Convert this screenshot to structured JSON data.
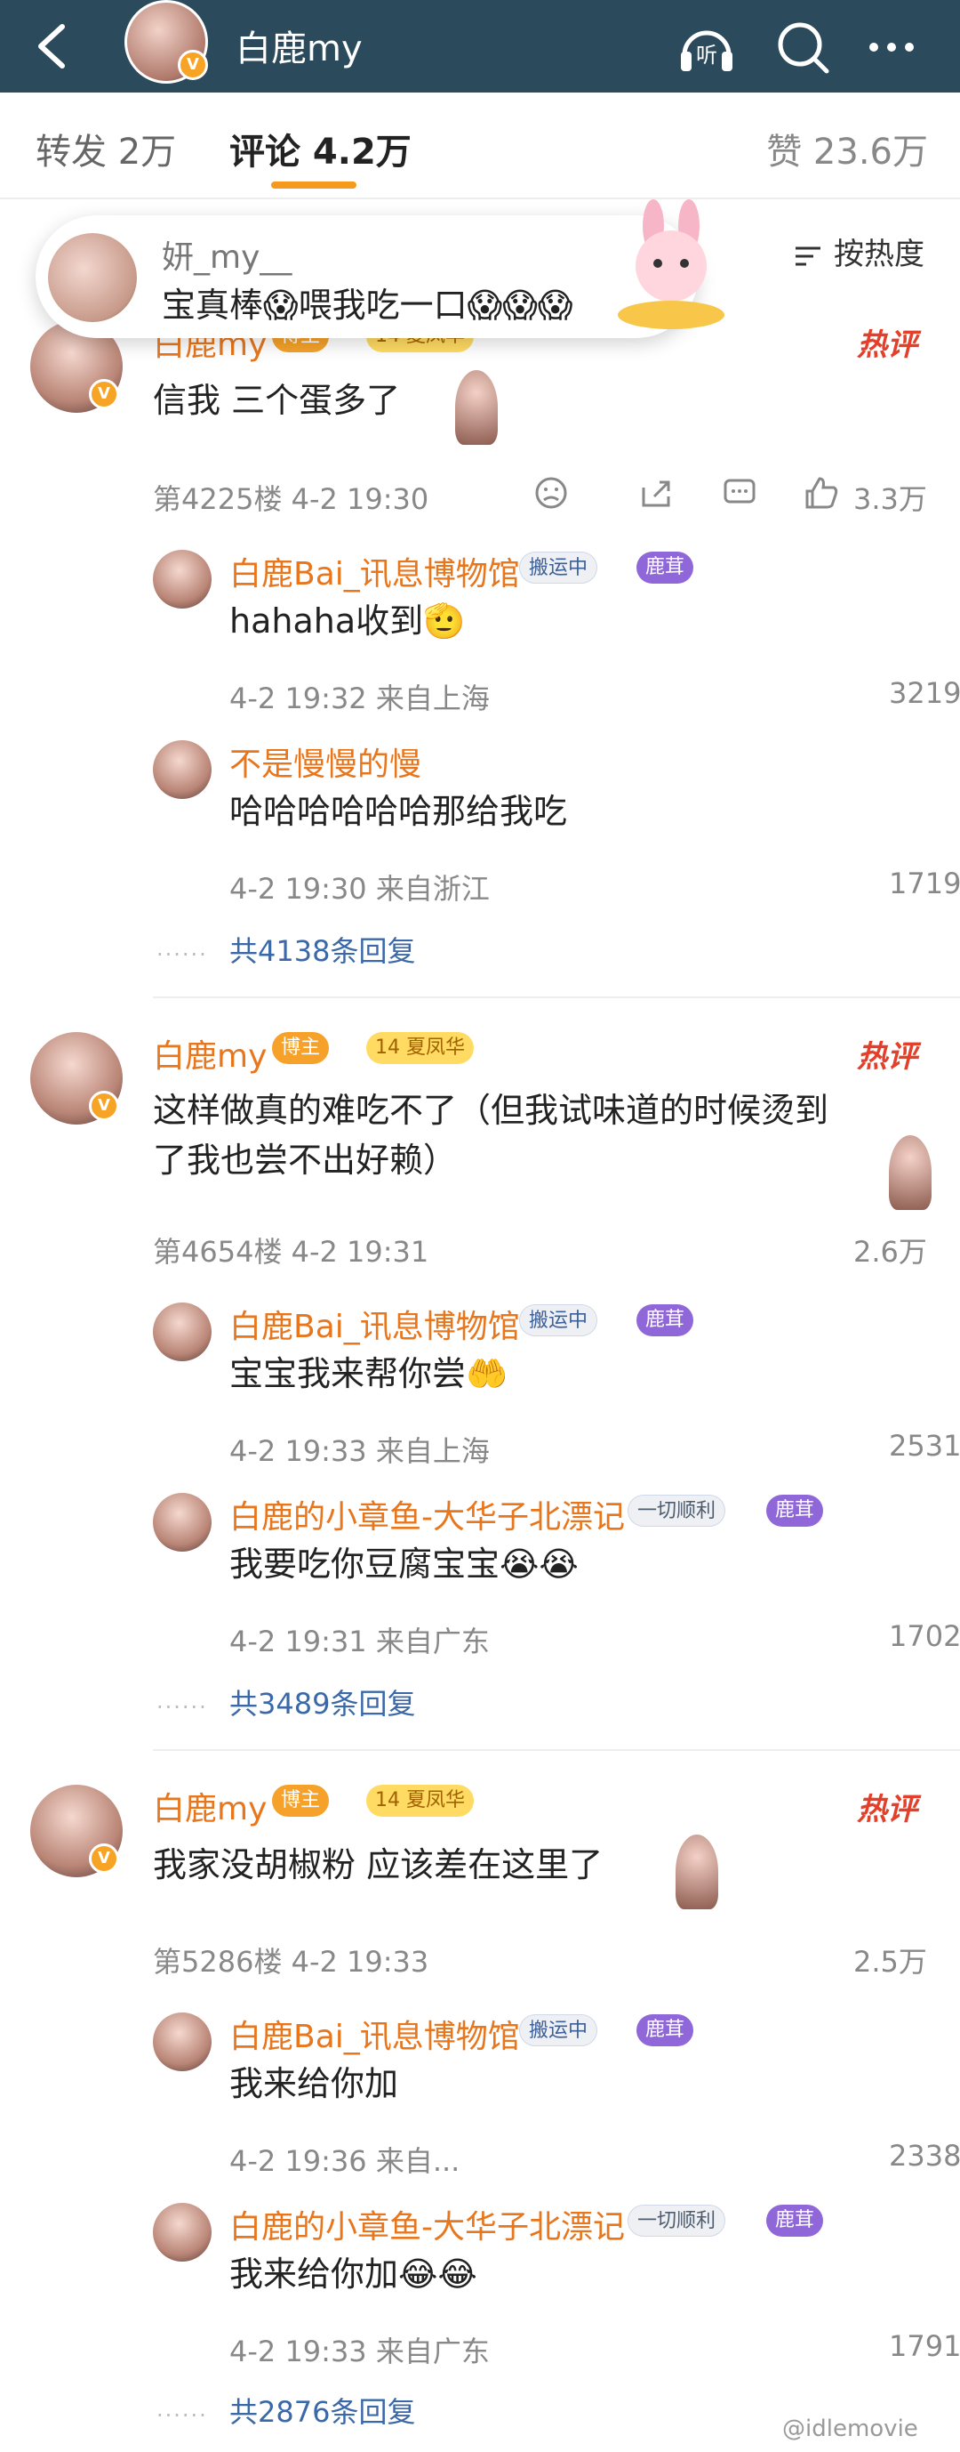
{
  "header": {
    "title": "白鹿my",
    "back_icon": "chevron-left-icon",
    "listen_label": "听"
  },
  "tabs": {
    "repost": "转发 2万",
    "comments": "评论 4.2万",
    "likes": "赞 23.6万"
  },
  "toast": {
    "name": "妍_my__",
    "text": "宝真棒😱喂我吃一口😱😱😱"
  },
  "sort": "按热度",
  "hot_label": "热评",
  "threads": [
    {
      "author": "白鹿my",
      "blogger": "博主",
      "lv": "14",
      "lv_text": "夏凤华",
      "text_lines": [
        "信我 三个蛋多了"
      ],
      "floor": "第4225楼 4-2 19:30",
      "likes": "3.3万",
      "replies": [
        {
          "name": "白鹿Bai_讯息博物馆",
          "tag": "搬运中",
          "fan": "鹿茸",
          "text": "hahaha收到🫡",
          "meta": "4-2 19:32 来自上海",
          "likes": "3219"
        },
        {
          "name": "不是慢慢的慢",
          "text": "哈哈哈哈哈哈那给我吃",
          "meta": "4-2 19:30 来自浙江",
          "likes": "1719"
        }
      ],
      "more": "共4138条回复"
    },
    {
      "author": "白鹿my",
      "blogger": "博主",
      "lv": "14",
      "lv_text": "夏凤华",
      "text_lines": [
        "这样做真的难吃不了（但我试味道的时候烫到",
        "了我也尝不出好赖）"
      ],
      "floor": "第4654楼 4-2 19:31",
      "likes": "2.6万",
      "replies": [
        {
          "name": "白鹿Bai_讯息博物馆",
          "tag": "搬运中",
          "fan": "鹿茸",
          "text": "宝宝我来帮你尝🤲",
          "meta": "4-2 19:33 来自上海",
          "likes": "2531"
        },
        {
          "name": "白鹿的小章鱼-大华子北漂记",
          "tag": "一切顺利",
          "fan": "鹿茸",
          "text": "我要吃你豆腐宝宝😭😭",
          "meta": "4-2 19:31 来自广东",
          "likes": "1702"
        }
      ],
      "more": "共3489条回复"
    },
    {
      "author": "白鹿my",
      "blogger": "博主",
      "lv": "14",
      "lv_text": "夏凤华",
      "text_lines": [
        "我家没胡椒粉 应该差在这里了"
      ],
      "floor": "第5286楼 4-2 19:33",
      "likes": "2.5万",
      "replies": [
        {
          "name": "白鹿Bai_讯息博物馆",
          "tag": "搬运中",
          "fan": "鹿茸",
          "text": "我来给你加",
          "meta": "4-2 19:36 来自...",
          "likes": "2338"
        },
        {
          "name": "白鹿的小章鱼-大华子北漂记",
          "tag": "一切顺利",
          "fan": "鹿茸",
          "text": "我来给你加😂😂",
          "meta": "4-2 19:33 来自广东",
          "likes": "1791"
        }
      ],
      "more": "共2876条回复"
    }
  ],
  "watermark": "@idlemovie"
}
